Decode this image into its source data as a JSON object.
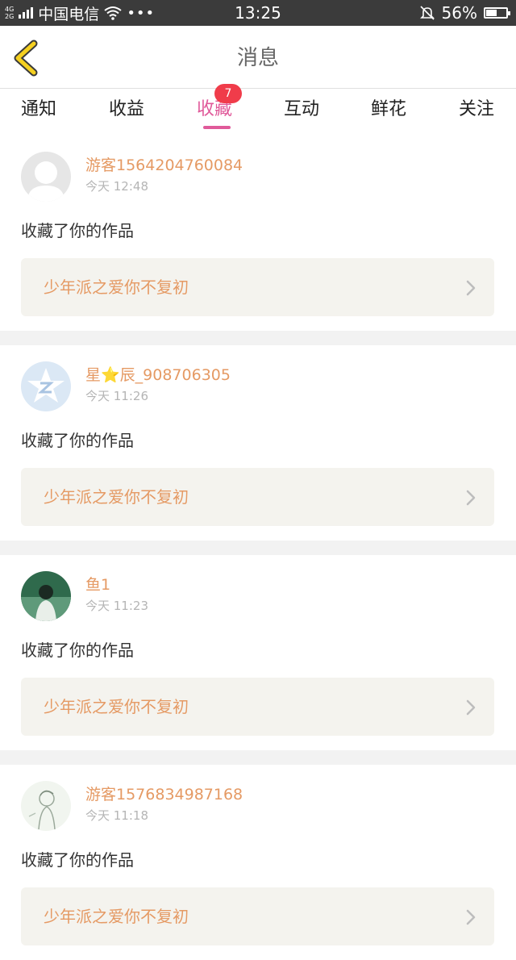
{
  "status_bar": {
    "network_top": "4G",
    "network_bottom": "2G",
    "carrier": "中国电信",
    "more": "•••",
    "time": "13:25",
    "battery": "56%",
    "battery_level": 0.56
  },
  "header": {
    "title": "消息",
    "back_icon": "chevron-left-icon"
  },
  "tabs": [
    {
      "label": "通知",
      "active": false
    },
    {
      "label": "收益",
      "active": false
    },
    {
      "label": "收藏",
      "active": true,
      "badge": "7"
    },
    {
      "label": "互动",
      "active": false
    },
    {
      "label": "鲜花",
      "active": false
    },
    {
      "label": "关注",
      "active": false
    }
  ],
  "messages": [
    {
      "user": "游客1564204760084",
      "time": "今天 12:48",
      "action": "收藏了你的作品",
      "work": "少年派之爱你不复初",
      "avatar": "default-avatar"
    },
    {
      "user": "星⭐辰_908706305",
      "time": "今天 11:26",
      "action": "收藏了你的作品",
      "work": "少年派之爱你不复初",
      "avatar": "qzone-star-avatar"
    },
    {
      "user": "鱼1",
      "time": "今天 11:23",
      "action": "收藏了你的作品",
      "work": "少年派之爱你不复初",
      "avatar": "photo-avatar"
    },
    {
      "user": "游客1576834987168",
      "time": "今天 11:18",
      "action": "收藏了你的作品",
      "work": "少年派之爱你不复初",
      "avatar": "sketch-avatar"
    }
  ],
  "colors": {
    "accent": "#e05a9a",
    "username": "#e59a64",
    "badge": "#f03c4a",
    "back_icon": "#f5d020"
  }
}
